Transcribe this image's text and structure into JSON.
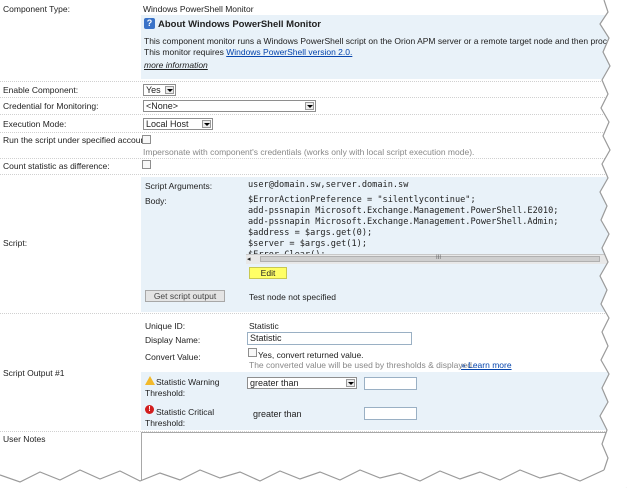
{
  "component_type": {
    "label": "Component Type:",
    "value": "Windows PowerShell Monitor"
  },
  "about": {
    "title": "About Windows PowerShell Monitor",
    "line1": "This component monitor runs a Windows PowerShell script on the Orion APM server or a remote target node and then processes the",
    "line2_prefix": "This monitor requires ",
    "line2_link": "Windows PowerShell version 2.0.",
    "more": "more information"
  },
  "enable": {
    "label": "Enable Component:",
    "value": "Yes"
  },
  "credential": {
    "label": "Credential for Monitoring:",
    "value": "<None>"
  },
  "execution": {
    "label": "Execution Mode:",
    "value": "Local Host"
  },
  "run_account": {
    "label": "Run the script under specified account:",
    "note": "Impersonate with component's credentials (works only with local script execution mode)."
  },
  "count_stat": {
    "label": "Count statistic as difference:"
  },
  "script": {
    "label": "Script:",
    "args_label": "Script Arguments:",
    "args_value": "user@domain.sw,server.domain.sw",
    "body_label": "Body:",
    "body_lines": [
      "$ErrorActionPreference = \"silentlycontinue\";",
      "add-pssnapin Microsoft.Exchange.Management.PowerShell.E2010;",
      "add-pssnapin Microsoft.Exchange.Management.PowerShell.Admin;",
      "$address = $args.get(0);",
      "$server = $args.get(1);",
      "$Error.Clear();"
    ],
    "scroll_mark": "III",
    "edit_label": "Edit",
    "get_output_label": "Get script output",
    "test_node": "Test node not specified"
  },
  "output": {
    "section_label": "Script Output #1",
    "unique_id_label": "Unique ID:",
    "unique_id_value": "Statistic",
    "display_name_label": "Display Name:",
    "display_name_value": "Statistic",
    "convert_label": "Convert Value:",
    "convert_check": "Yes, convert returned value.",
    "convert_note": "The converted value will be used by thresholds & displayed.",
    "learn_more": "» Learn more",
    "warning_label_1": "Statistic Warning",
    "warning_label_2": "Threshold:",
    "warning_op": "greater than",
    "critical_label_1": "Statistic Critical",
    "critical_label_2": "Threshold:",
    "critical_op": "greater than"
  },
  "user_notes": {
    "label": "User Notes"
  },
  "colors": {
    "panel": "#e9f2f9",
    "edit_button": "#ffff66",
    "link": "#0645ad",
    "warning": "#f2b92b",
    "critical": "#d21e1e"
  },
  "icons": [
    "help-icon",
    "dropdown-arrow-icon",
    "warning-icon",
    "critical-icon"
  ]
}
